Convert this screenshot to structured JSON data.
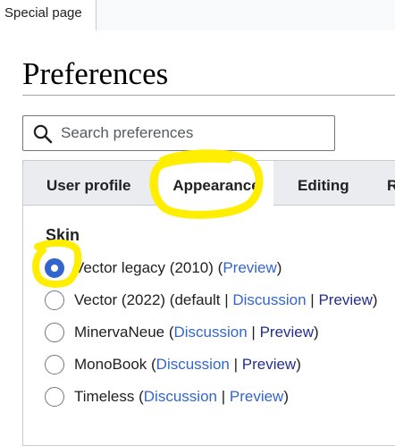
{
  "top_tab": {
    "label": "Special page"
  },
  "page": {
    "title": "Preferences"
  },
  "search": {
    "placeholder": "Search preferences",
    "icon": "search-icon"
  },
  "tabs": [
    {
      "label": "User profile",
      "active": false
    },
    {
      "label": "Appearance",
      "active": true
    },
    {
      "label": "Editing",
      "active": false
    },
    {
      "label": "R",
      "active": false
    }
  ],
  "skin": {
    "heading": "Skin",
    "options": [
      {
        "name": "Vector legacy (2010)",
        "selected": true,
        "links": [
          "Preview"
        ]
      },
      {
        "name": "Vector (2022)",
        "suffix": "default",
        "selected": false,
        "links": [
          "Discussion",
          "Preview"
        ]
      },
      {
        "name": "MinervaNeue",
        "selected": false,
        "links": [
          "Discussion",
          "Preview"
        ]
      },
      {
        "name": "MonoBook",
        "selected": false,
        "links": [
          "Discussion",
          "Preview"
        ]
      },
      {
        "name": "Timeless",
        "selected": false,
        "links": [
          "Discussion",
          "Preview"
        ]
      }
    ]
  },
  "colors": {
    "link": "#3366cc",
    "radio_checked": "#3366cc",
    "highlight": "#ffee00",
    "tabs_bg": "#eaecf0"
  }
}
